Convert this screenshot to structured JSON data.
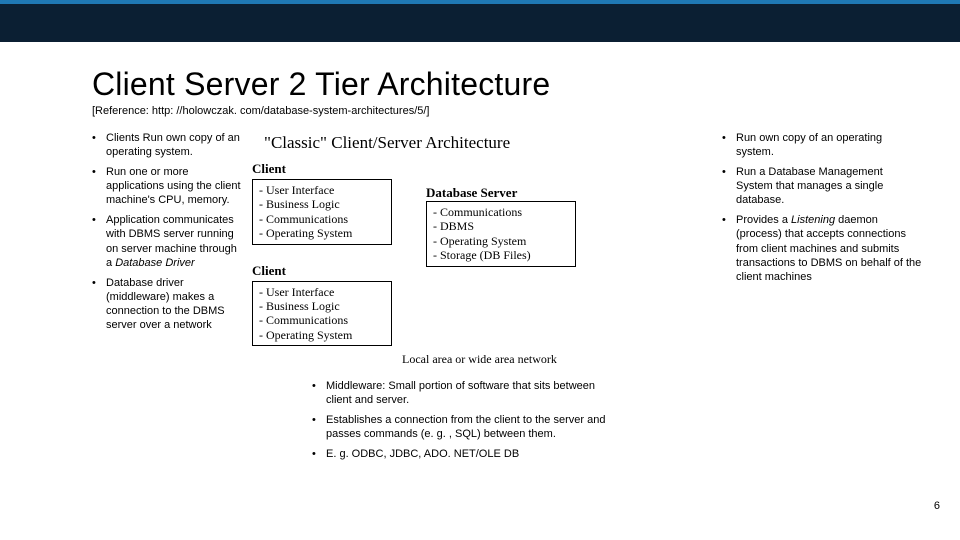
{
  "title": "Client Server 2 Tier Architecture",
  "reference": "[Reference: http: //holowczak. com/database-system-architectures/5/]",
  "left_bullets": [
    "Clients Run own copy of an operating system.",
    "Run one or more applications using the client machine's CPU, memory.",
    "Application communicates with DBMS server running on server machine through a ",
    "Database driver (middleware) makes a connection to the DBMS server over a network"
  ],
  "left_italic": "Database Driver",
  "diagram": {
    "title": "\"Classic\" Client/Server Architecture",
    "client_label": "Client",
    "client_lines": [
      "- User Interface",
      "- Business Logic",
      "- Communications",
      "- Operating System"
    ],
    "server_label": "Database Server",
    "server_lines": [
      "- Communications",
      "- DBMS",
      "- Operating System",
      "- Storage (DB Files)"
    ],
    "footer": "Local area or wide area network"
  },
  "mid_bullets": [
    "Middleware: Small portion of software that sits between client and server.",
    "Establishes a connection from the client to the server and passes commands (e. g. , SQL) between them.",
    "E. g. ODBC, JDBC, ADO. NET/OLE DB"
  ],
  "right_bullets_a": "Run own copy of an operating system.",
  "right_bullets_b": "Run a Database Management System that manages a single database.",
  "right_bullets_c_pre": "Provides a ",
  "right_bullets_c_em": "Listening",
  "right_bullets_c_post": " daemon (process) that accepts connections from client machines and submits transactions to DBMS on behalf of the client machines",
  "page_number": "6"
}
